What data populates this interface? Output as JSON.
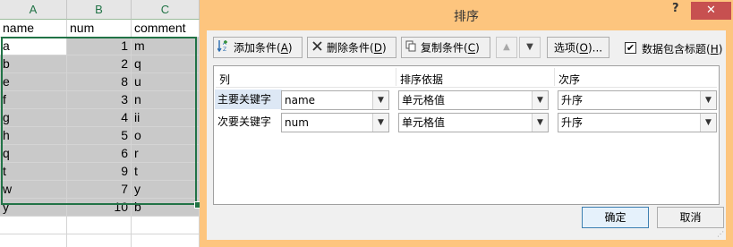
{
  "sheet": {
    "columns": [
      "A",
      "B",
      "C"
    ],
    "header_row": [
      "name",
      "num",
      "comment"
    ],
    "rows": [
      [
        "a",
        "1",
        "m"
      ],
      [
        "b",
        "2",
        "q"
      ],
      [
        "e",
        "8",
        "u"
      ],
      [
        "f",
        "3",
        "n"
      ],
      [
        "g",
        "4",
        "ii"
      ],
      [
        "h",
        "5",
        "o"
      ],
      [
        "q",
        "6",
        "r"
      ],
      [
        "t",
        "9",
        "t"
      ],
      [
        "w",
        "7",
        "y"
      ],
      [
        "y",
        "10",
        "b"
      ]
    ],
    "accent_color": "#217346"
  },
  "dialog": {
    "title": "排序",
    "help_label": "?",
    "close_label": "✕",
    "toolbar": {
      "add_label": "添加条件(",
      "add_key": "A",
      "delete_label": "删除条件(",
      "delete_key": "D",
      "copy_label": "复制条件(",
      "copy_key": "C",
      "options_label": "选项(",
      "options_key": "O",
      "options_suffix": ")...",
      "close_paren": ")"
    },
    "has_headers": {
      "checked": true,
      "check_mark": "✔",
      "label": "数据包含标题(",
      "key": "H",
      "suffix": ")"
    },
    "table": {
      "headers": {
        "column": "列",
        "sort_on": "排序依据",
        "order": "次序"
      },
      "levels": [
        {
          "label": "主要关键字",
          "column": "name",
          "sort_on": "单元格值",
          "order": "升序",
          "selected": true
        },
        {
          "label": "次要关键字",
          "column": "num",
          "sort_on": "单元格值",
          "order": "升序",
          "selected": false
        }
      ]
    },
    "ok_label": "确定",
    "cancel_label": "取消",
    "frame_color": "#fdc57e"
  }
}
